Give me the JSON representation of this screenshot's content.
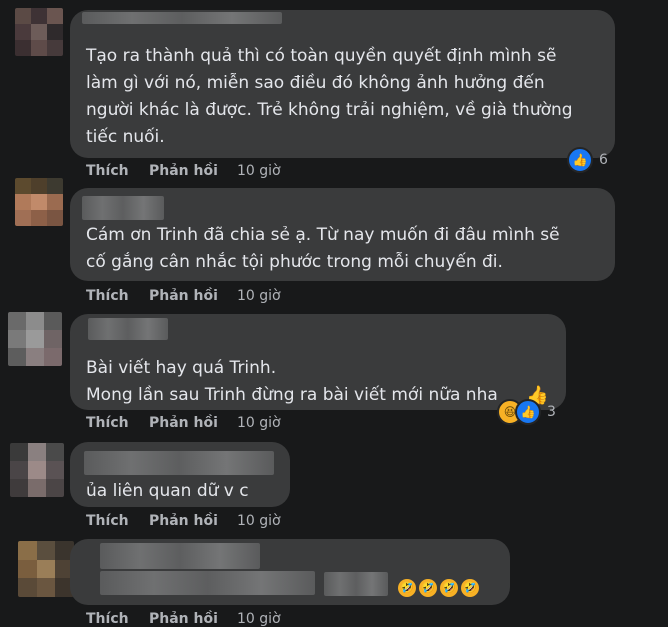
{
  "comments": [
    {
      "lines": [
        "Tạo ra thành quả thì có toàn quyền quyết định mình sẽ",
        "làm gì với nó, miễn sao điều đó không ảnh hưởng đến",
        "người khác là được. Trẻ không trải nghiệm, về già thường",
        "tiếc nuối."
      ],
      "like_label": "Thích",
      "reply_label": "Phản hồi",
      "time": "10 giờ",
      "reaction_count": "6"
    },
    {
      "lines": [
        "Cám ơn Trinh đã chia sẻ ạ. Từ nay muốn đi đâu mình sẽ",
        "cố gắng cân nhắc tội phước trong mỗi chuyến đi."
      ],
      "like_label": "Thích",
      "reply_label": "Phản hồi",
      "time": "10 giờ"
    },
    {
      "lines": [
        "Bài viết hay quá Trinh.",
        "Mong lần sau Trinh đừng ra bài viết mới nữa nha"
      ],
      "like_label": "Thích",
      "reply_label": "Phản hồi",
      "time": "10 giờ",
      "reaction_count": "3"
    },
    {
      "lines": [
        "ủa liên quan dữ v c"
      ],
      "like_label": "Thích",
      "reply_label": "Phản hồi",
      "time": "10 giờ"
    },
    {
      "lines": [
        ""
      ],
      "like_label": "Thích",
      "reply_label": "Phản hồi",
      "time": "10 giờ"
    }
  ],
  "icons": {
    "like": "thumbs-up-icon",
    "haha": "laughing-face-icon",
    "rofl": "rolling-on-floor-laughing-icon"
  },
  "colors": {
    "background": "#18191a",
    "bubble": "#3a3b3c",
    "text": "#e4e6eb",
    "muted": "#b0b3b8",
    "like_blue": "#1877f2"
  }
}
